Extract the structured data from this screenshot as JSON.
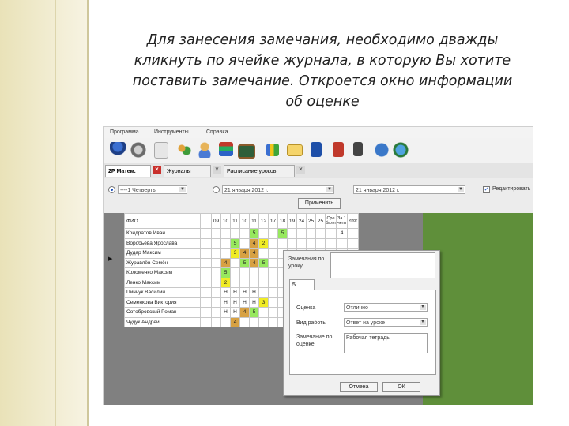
{
  "caption": {
    "line1": "Для занесения замечания, необходимо дважды",
    "line2": "кликнуть по ячейке журнала, в которую Вы хотите",
    "line3": "поставить замечание. Откроется окно информации",
    "line4": "об оценке"
  },
  "menu": {
    "program": "Программа",
    "tools": "Инструменты",
    "help": "Справка"
  },
  "tabs": [
    {
      "label": "2Р Матем."
    },
    {
      "label": "Журналы"
    },
    {
      "label": "Расписание уроков"
    }
  ],
  "filters": {
    "quarter": "----1 Четверть",
    "date_from": "21 января 2012 г.",
    "date_to": "21 января 2012 г.",
    "apply_button": "Применить",
    "edit_checkbox_label": "Редактировать",
    "edit_checked": true
  },
  "journal": {
    "name_header": "ФИО",
    "date_columns": [
      "09",
      "10",
      "11",
      "10",
      "11",
      "12",
      "17",
      "18",
      "19",
      "24",
      "25",
      "25"
    ],
    "right_columns": [
      "Сре балл",
      "За 1 четв",
      "Итог"
    ],
    "rows": [
      {
        "name": "Кондратов Иван",
        "cells": [
          "",
          "",
          "",
          "",
          "",
          "5",
          "",
          "",
          "5",
          "",
          "",
          "",
          ""
        ],
        "right": [
          "",
          "4",
          ""
        ]
      },
      {
        "name": "Воробьёва Ярослава",
        "cells": [
          "",
          "",
          "",
          "5",
          "",
          "4",
          "2",
          "",
          "",
          "",
          "",
          "",
          ""
        ],
        "right": [
          "",
          "",
          "",
          ""
        ]
      },
      {
        "name": "Дудар Максим",
        "cells": [
          "",
          "",
          "",
          "3",
          "4",
          "4",
          "",
          "",
          "",
          "",
          "",
          "",
          ""
        ],
        "right": [
          "",
          "",
          "",
          ""
        ]
      },
      {
        "name": "Журавлёв Семён",
        "cells": [
          "",
          "",
          "4",
          "",
          "5",
          "4",
          "5",
          "",
          "",
          "",
          "",
          "",
          ""
        ],
        "right": [
          "",
          "",
          "",
          ""
        ]
      },
      {
        "name": "Коломенко Максим",
        "cells": [
          "",
          "",
          "5",
          "",
          "",
          "",
          "",
          "",
          "",
          "",
          "",
          "",
          ""
        ],
        "right": [
          "",
          "",
          "",
          ""
        ]
      },
      {
        "name": "Ленко Максим",
        "cells": [
          "",
          "",
          "2",
          "",
          "",
          "",
          "",
          "",
          "",
          "",
          "",
          "",
          ""
        ],
        "right": [
          "",
          "",
          "",
          ""
        ]
      },
      {
        "name": "Пинчук Василий",
        "cells": [
          "",
          "",
          "Н",
          "Н",
          "Н",
          "Н",
          "",
          "",
          "",
          "",
          "",
          "",
          ""
        ],
        "right": [
          "",
          "",
          "",
          ""
        ]
      },
      {
        "name": "Семенкова Виктория",
        "cells": [
          "",
          "",
          "Н",
          "Н",
          "Н",
          "Н",
          "3",
          "",
          "",
          "",
          "",
          "",
          ""
        ],
        "right": [
          "",
          "",
          "",
          ""
        ]
      },
      {
        "name": "Сотобровский Роман",
        "cells": [
          "",
          "",
          "Н",
          "Н",
          "4",
          "5",
          "",
          "",
          "",
          "",
          "",
          "",
          ""
        ],
        "right": [
          "",
          "",
          "",
          ""
        ]
      },
      {
        "name": "Чудук Андрей",
        "cells": [
          "",
          "",
          "",
          "4",
          "",
          "",
          "",
          "",
          "",
          "",
          "",
          "",
          ""
        ],
        "right": [
          "",
          "",
          "",
          ""
        ]
      }
    ]
  },
  "popup": {
    "lesson_note_label": "Замечания по уроку",
    "tab_label": "5",
    "grade_label": "Оценка",
    "grade_value": "Отлично",
    "work_type_label": "Вид работы",
    "work_type_value": "Ответ на уроке",
    "note_label": "Замечание по оценке",
    "note_value": "Рабочая тетрадь",
    "cancel_button": "Отмена",
    "ok_button": "ОК"
  },
  "colors": {
    "grade_green": "#97e85e",
    "grade_orange": "#d7a143",
    "grade_yellow": "#f0ec26",
    "close_red": "#c9302c"
  }
}
